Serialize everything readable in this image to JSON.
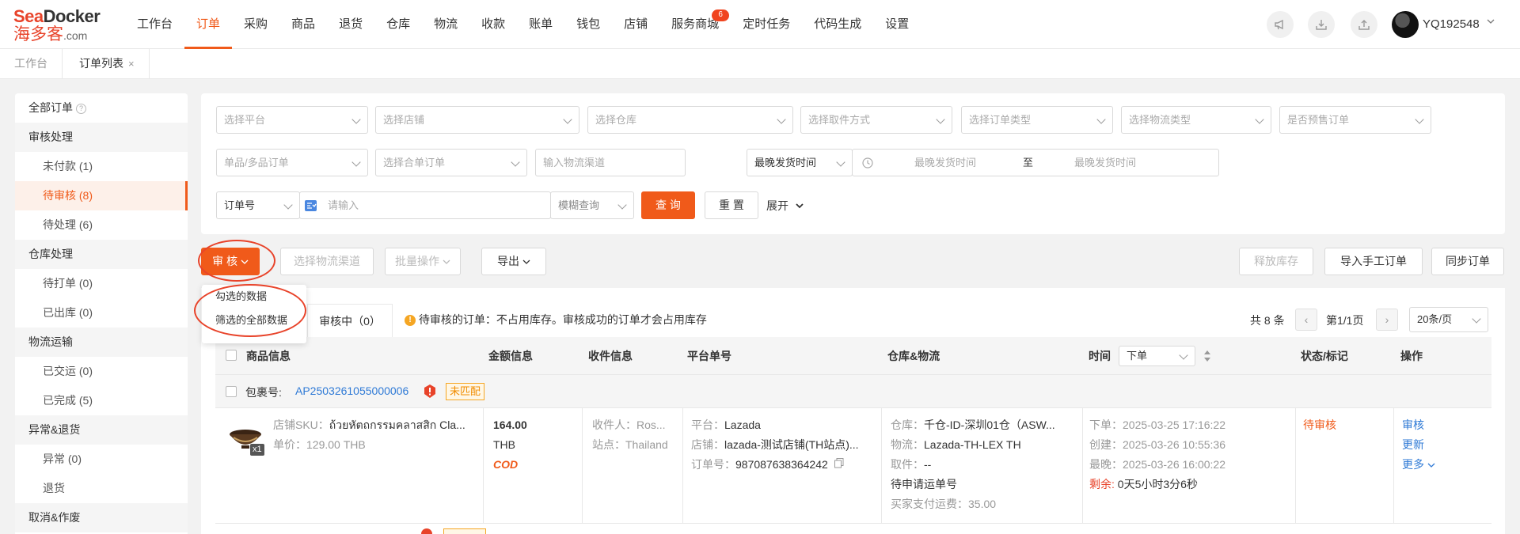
{
  "logo": {
    "line1_a": "Sea",
    "line1_b": "Docker",
    "line2": "海多客",
    "line2_suffix": ".com"
  },
  "nav": {
    "items": [
      "工作台",
      "订单",
      "采购",
      "商品",
      "退货",
      "仓库",
      "物流",
      "收款",
      "账单",
      "钱包",
      "店铺",
      "服务商城",
      "定时任务",
      "代码生成",
      "设置"
    ],
    "active_index": 1,
    "badge_value": "6"
  },
  "user": {
    "name": "YQ192548"
  },
  "tabs": {
    "t1": "工作台",
    "t2": "订单列表",
    "close": "×"
  },
  "sidebar": {
    "all_orders": "全部订单",
    "g1": "审核处理",
    "g1_items": [
      "未付款 (1)",
      "待审核 (8)",
      "待处理 (6)"
    ],
    "g2": "仓库处理",
    "g2_items": [
      "待打单 (0)",
      "已出库 (0)"
    ],
    "g3": "物流运输",
    "g3_items": [
      "已交运 (0)",
      "已完成 (5)"
    ],
    "g4": "异常&退货",
    "g4_items": [
      "异常 (0)",
      "退货"
    ],
    "g5": "取消&作废"
  },
  "filters": {
    "platform": "选择平台",
    "shop": "选择店铺",
    "warehouse": "选择仓库",
    "pickup": "选择取件方式",
    "order_type": "选择订单类型",
    "logistics_type": "选择物流类型",
    "presale": "是否预售订单",
    "single_multi": "单品/多品订单",
    "merge": "选择合单订单",
    "channel_placeholder": "输入物流渠道",
    "latest_ship": "最晚发货时间",
    "start": "最晚发货时间",
    "to": "至",
    "end": "最晚发货时间",
    "order_no": "订单号",
    "input_placeholder": "请输入",
    "fuzzy": "模糊查询",
    "query": "查 询",
    "reset": "重 置",
    "expand": "展开"
  },
  "actions": {
    "audit": "审 核",
    "choose_channel": "选择物流渠道",
    "batch": "批量操作",
    "export": "导出",
    "release_stock": "释放库存",
    "import_manual": "导入手工订单",
    "sync": "同步订单"
  },
  "dropdown": {
    "opt1": "勾选的数据",
    "opt2": "筛选的全部数据"
  },
  "list": {
    "subtab_auditing": "审核中（0）",
    "notice": "待审核的订单：不占用库存。审核成功的订单才会占用库存",
    "total": "共 8 条",
    "page": "第1/1页",
    "page_size": "20条/页",
    "prev": "‹",
    "next": "›"
  },
  "table": {
    "headers": [
      "商品信息",
      "金额信息",
      "收件信息",
      "平台单号",
      "仓库&物流",
      "时间",
      "状态/标记",
      "操作"
    ],
    "time_sort": "下单"
  },
  "package": {
    "label": "包裹号:",
    "number": "AP2503261055000006",
    "tag": "未匹配"
  },
  "order": {
    "qty": "x1",
    "sku_label": "店铺SKU：",
    "sku_value": "ถ้วยหัตถกรรมคลาสสิก Cla...",
    "unit_price": "单价：129.00 THB",
    "amount": "164.00",
    "currency": "THB",
    "payment": "COD",
    "receiver_label": "收件人：",
    "receiver_value": "Ros...",
    "site_label": "站点：",
    "site_value": "Thailand",
    "platform_label": "平台：",
    "platform_value": "Lazada",
    "shop_label": "店铺：",
    "shop_value": "lazada-测试店铺(TH站点)...",
    "orderno_label": "订单号：",
    "orderno_value": "987087638364242",
    "wh_label": "仓库：",
    "wh_value": "千仓-ID-深圳01仓（ASW...",
    "logi_label": "物流：",
    "logi_value": "Lazada-TH-LEX TH",
    "pick_label": "取件：",
    "pick_value": "--",
    "tracking": "待申请运单号",
    "shipping_fee": "买家支付运费：35.00",
    "t_order": "下单：2025-03-25 17:16:22",
    "t_created": "创建：2025-03-26 10:55:36",
    "t_latest": "最晚：2025-03-26 16:00:22",
    "t_remain_label": "剩余:",
    "t_remain_value": "0天5小时3分6秒",
    "status": "待审核",
    "op_audit": "审核",
    "op_update": "更新",
    "op_more": "更多"
  },
  "colors": {
    "accent": "#f05a1a",
    "link": "#2f7ad6",
    "annotation": "#e8432a"
  }
}
